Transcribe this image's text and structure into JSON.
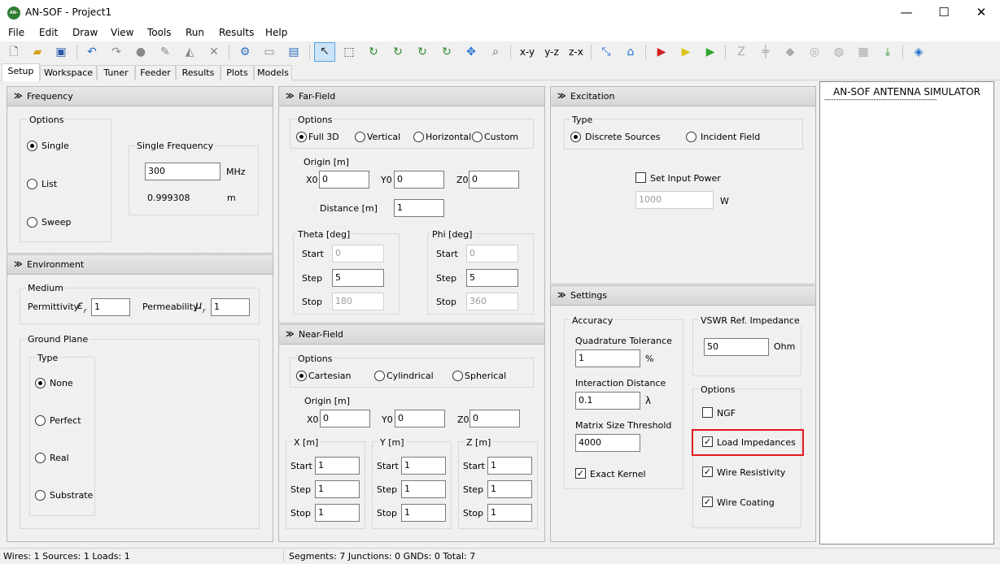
{
  "window": {
    "title": "AN-SOF - Project1",
    "logo": "AN-SOF",
    "minimize_icon": "—",
    "maximize_icon": "☐",
    "close_icon": "✕"
  },
  "menu": [
    "File",
    "Edit",
    "Draw",
    "View",
    "Tools",
    "Run",
    "Results",
    "Help"
  ],
  "toolbar_text": {
    "xy": "x-y",
    "yz": "y-z",
    "zx": "z-x"
  },
  "tabs": [
    "Setup",
    "Workspace",
    "Tuner",
    "Feeder",
    "Results",
    "Plots",
    "Models"
  ],
  "frequency": {
    "header": "Frequency",
    "options_label": "Options",
    "single": "Single",
    "list": "List",
    "sweep": "Sweep",
    "single_freq_label": "Single Frequency",
    "freq_value": "300",
    "freq_unit": "MHz",
    "wavelength": "0.999308",
    "wavelength_unit": "m"
  },
  "environment": {
    "header": "Environment",
    "medium_label": "Medium",
    "permittivity_label": "Permittivity",
    "epsilon": "ε",
    "permittivity_value": "1",
    "permeability_label": "Permeability",
    "mu": "μ",
    "sub_r": "r",
    "permeability_value": "1",
    "ground_plane_label": "Ground Plane",
    "type_label": "Type",
    "none": "None",
    "perfect": "Perfect",
    "real": "Real",
    "substrate": "Substrate"
  },
  "farfield": {
    "header": "Far-Field",
    "options_label": "Options",
    "full3d": "Full 3D",
    "vertical": "Vertical",
    "horizontal": "Horizontal",
    "custom": "Custom",
    "origin_label": "Origin [m]",
    "x0": "X0",
    "y0": "Y0",
    "z0": "Z0",
    "x0_val": "0",
    "y0_val": "0",
    "z0_val": "0",
    "distance_label": "Distance [m]",
    "distance_val": "1",
    "theta_label": "Theta [deg]",
    "phi_label": "Phi [deg]",
    "start": "Start",
    "step": "Step",
    "stop": "Stop",
    "theta_start": "0",
    "theta_step": "5",
    "theta_stop": "180",
    "phi_start": "0",
    "phi_step": "5",
    "phi_stop": "360"
  },
  "nearfield": {
    "header": "Near-Field",
    "options_label": "Options",
    "cartesian": "Cartesian",
    "cylindrical": "Cylindrical",
    "spherical": "Spherical",
    "origin_label": "Origin [m]",
    "x0": "X0",
    "y0": "Y0",
    "z0": "Z0",
    "x0_val": "0",
    "y0_val": "0",
    "z0_val": "0",
    "x_label": "X [m]",
    "y_label": "Y [m]",
    "z_label": "Z [m]",
    "start": "Start",
    "step": "Step",
    "stop": "Stop",
    "val": "1"
  },
  "excitation": {
    "header": "Excitation",
    "type_label": "Type",
    "discrete": "Discrete Sources",
    "incident": "Incident Field",
    "set_power": "Set Input Power",
    "power_val": "1000",
    "power_unit": "W"
  },
  "settings": {
    "header": "Settings",
    "accuracy_label": "Accuracy",
    "quad_label": "Quadrature Tolerance",
    "quad_val": "1",
    "quad_unit": "%",
    "interaction_label": "Interaction Distance",
    "interaction_val": "0.1",
    "interaction_unit": "λ",
    "matrix_label": "Matrix Size Threshold",
    "matrix_val": "4000",
    "exact_kernel": "Exact Kernel",
    "vswr_label": "VSWR Ref. Impedance",
    "vswr_val": "50",
    "vswr_unit": "Ohm",
    "options_label": "Options",
    "ngf": "NGF",
    "load_imp": "Load Impedances",
    "wire_res": "Wire Resistivity",
    "wire_coat": "Wire Coating"
  },
  "simulator": {
    "title": "AN-SOF ANTENNA SIMULATOR",
    "rule": "------------------------------------------------"
  },
  "status": {
    "left": "Wires: 1  Sources: 1  Loads: 1",
    "right": "Segments: 7  Junctions: 0  GNDs: 0  Total: 7"
  }
}
